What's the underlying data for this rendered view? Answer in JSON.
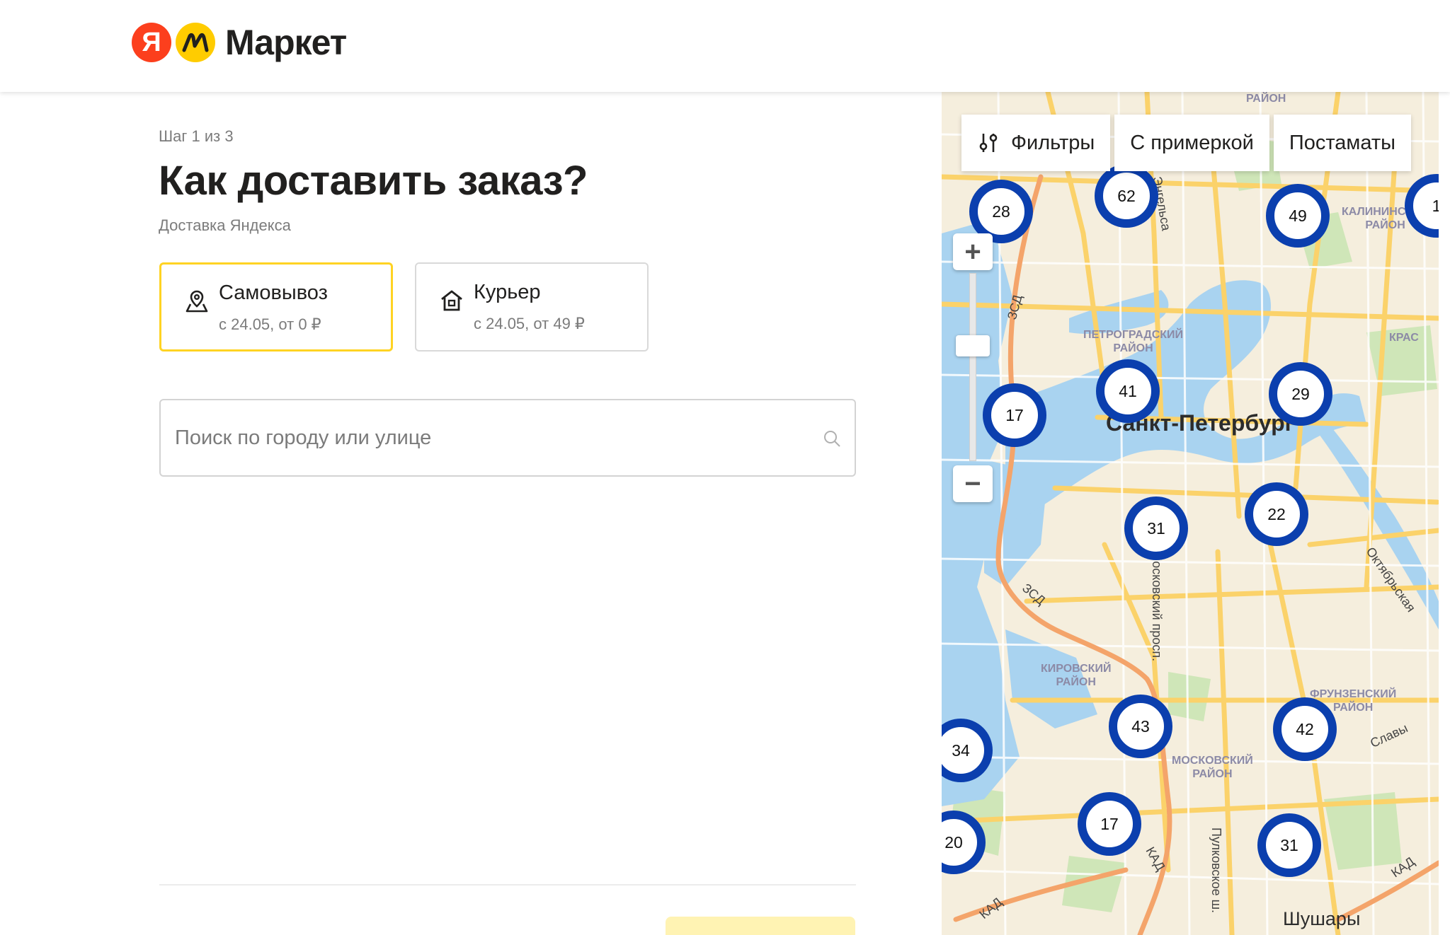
{
  "header": {
    "logo_ya": "Я",
    "logo_text": "Маркет"
  },
  "step": "Шаг 1 из 3",
  "title": "Как доставить заказ?",
  "subtitle": "Доставка Яндекса",
  "delivery_options": [
    {
      "title": "Самовывоз",
      "sub": "с 24.05, от 0 ₽",
      "selected": true,
      "icon": "pickup-point-icon"
    },
    {
      "title": "Курьер",
      "sub": "с 24.05, от 49 ₽",
      "selected": false,
      "icon": "house-icon"
    }
  ],
  "search": {
    "placeholder": "Поиск по городу или улице",
    "value": ""
  },
  "map": {
    "chips": {
      "filters": "Фильтры",
      "fitting": "С примеркой",
      "postamats": "Постаматы"
    },
    "clusters": [
      "28",
      "62",
      "49",
      "1",
      "41",
      "29",
      "17",
      "31",
      "22",
      "34",
      "43",
      "42",
      "20",
      "17",
      "31"
    ],
    "labels": {
      "city": "Санкт-Петербург",
      "petrogradsky": "ПЕТРОГРАДСКИЙ\nРАЙОН",
      "kirovsky": "КИРОВСКИЙ\nРАЙОН",
      "moskovsky": "МОСКОВСКИЙ\nРАЙОН",
      "frunzensky": "ФРУНЗЕНСКИЙ\nРАЙОН",
      "kalininsky": "КАЛИНИНСКИЙ\nРАЙОН",
      "krasnogvard": "КРАС",
      "rayon_top": "РАЙОН",
      "shushary": "Шушары",
      "zsd1": "ЗСД",
      "zsd2": "ЗСД",
      "kad1": "КАД",
      "kad2": "КАД",
      "kad3": "КАД",
      "moskovsky_prosp": "Московский просп.",
      "pulkovskoe": "Пулковское ш.",
      "oktyabrskaya": "Октябрьская",
      "slavy": "Славы",
      "engelsa": "Энгельса"
    },
    "colors": {
      "water": "#a9d3f0",
      "land": "#f5eedd",
      "road": "#fbd26a",
      "kad": "#f4a46a",
      "park": "#cfe6b8",
      "cluster": "#0b3fae"
    }
  },
  "accent": "#ffd323"
}
